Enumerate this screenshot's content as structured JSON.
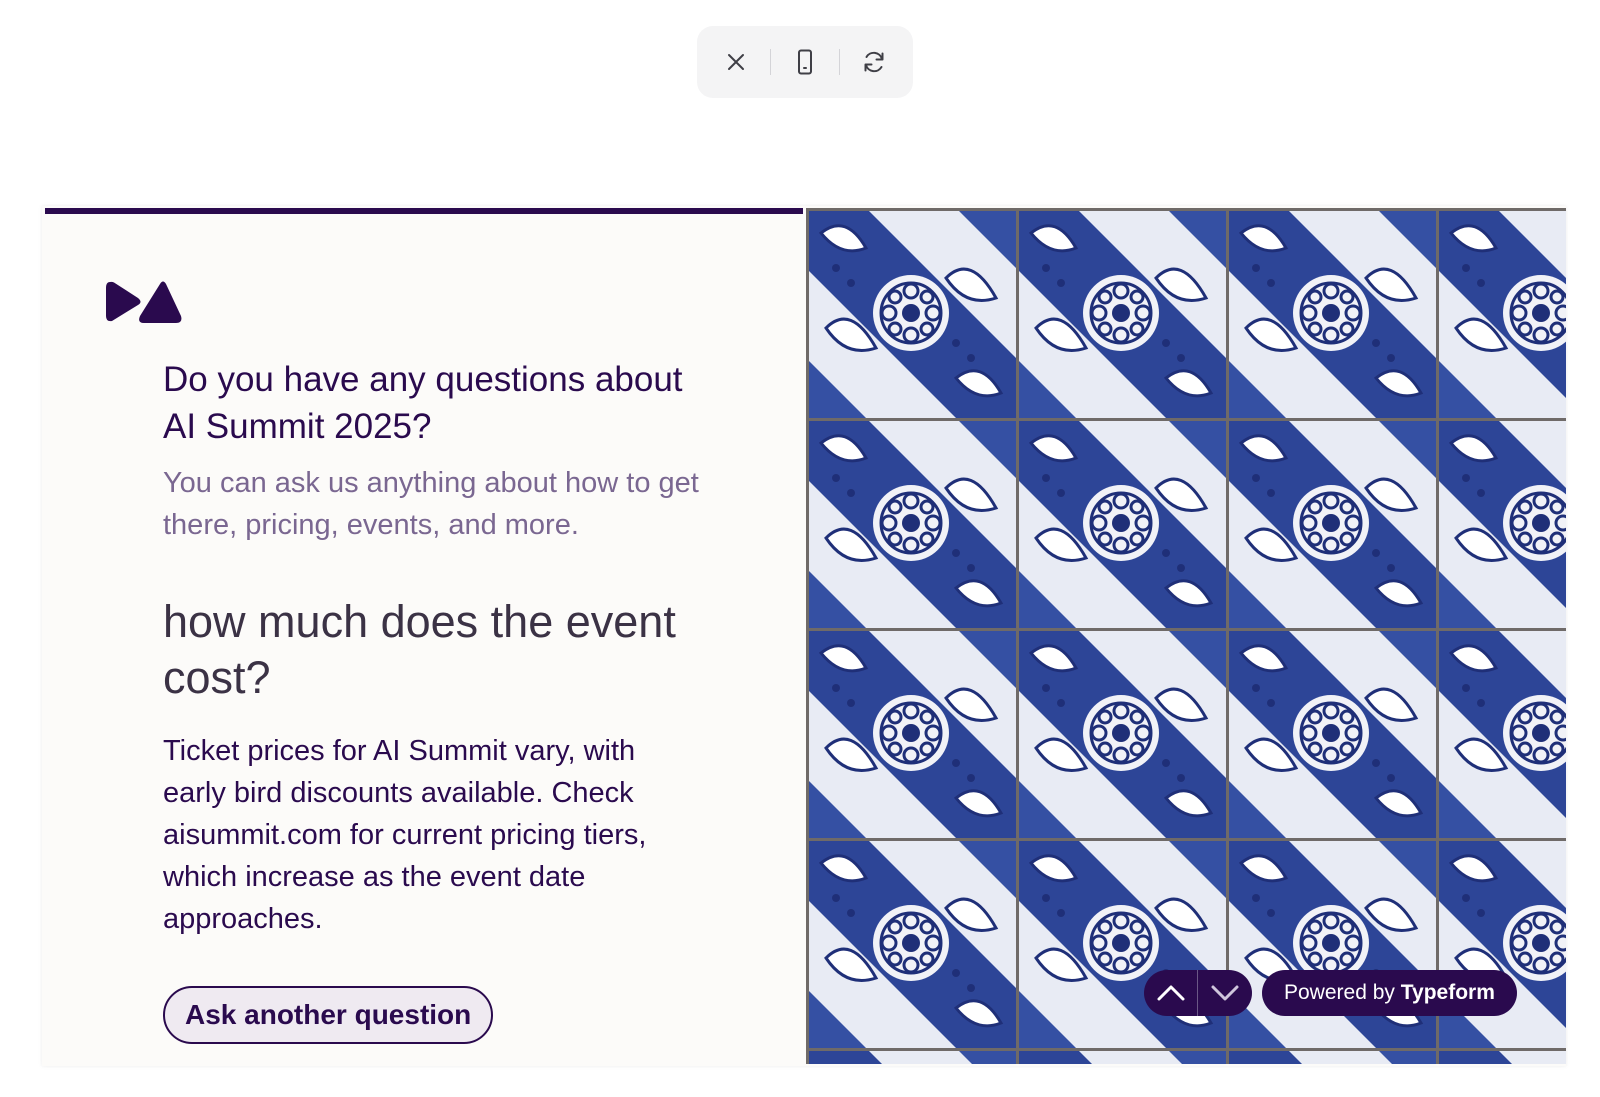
{
  "toolbar": {
    "close_icon": "close-icon",
    "device_icon": "mobile-device-icon",
    "refresh_icon": "refresh-icon"
  },
  "form": {
    "accent_color": "#2a0a4e",
    "background_color": "#fcfbf9",
    "logo_icon": "brand-logo-icon",
    "question_title": "Do you have any questions about AI Summit 2025?",
    "question_description": "You can ask us anything about how to get there, pricing, events, and more.",
    "user_question": "how much does the event cost?",
    "answer": "Ticket prices for AI Summit vary, with early bird discounts available. Check aisummit.com for current pricing tiers, which increase as the event date approaches.",
    "ask_another_label": "Ask another question"
  },
  "image_panel": {
    "image": "blue-white-floral-tiles"
  },
  "navigation": {
    "up_icon": "chevron-up-icon",
    "down_icon": "chevron-down-icon"
  },
  "branding": {
    "powered_prefix": "Powered by",
    "brand_name": "Typeform"
  }
}
